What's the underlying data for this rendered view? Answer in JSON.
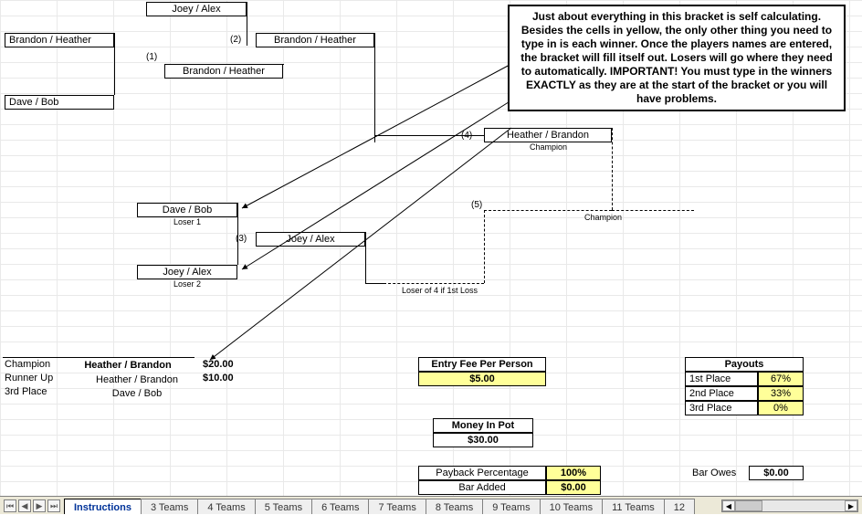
{
  "callout_text": "Just about everything in this bracket is self calculating. Besides the cells in yellow, the only other thing you need to type in is each winner. Once the players names are entered, the bracket will fill itself out. Losers will go where they need to automatically. IMPORTANT! You must type in the winners EXACTLY as they are at the start of the bracket or you will have problems.",
  "bracket": {
    "seed1_team": "Brandon / Heather",
    "seed1_match_label": "(1)",
    "header_team": "Joey / Alex",
    "seed2_box_team": "Brandon / Heather",
    "winner1": "Brandon / Heather",
    "seed2_match_label": "(2)",
    "seed3_team": "Dave / Bob",
    "loser_bracket_top": "Dave / Bob",
    "loser1_label": "Loser 1",
    "seed3_match_label": "(3)",
    "loser_bracket_bot": "Joey / Alex",
    "loser2_label": "Loser 2",
    "loser_winner": "Joey / Alex",
    "seed4_label": "(4)",
    "final_left": "Heather / Brandon",
    "champion_label_small": "Champion",
    "seed5_label": "(5)",
    "champion_label2": "Champion",
    "loser4_label": "Loser of 4 if 1st Loss"
  },
  "results": {
    "champion_label": "Champion",
    "champion_name": "Heather / Brandon",
    "champion_amt": "$20.00",
    "runnerup_label": "Runner Up",
    "runnerup_name": "Heather / Brandon",
    "runnerup_amt": "$10.00",
    "third_label": "3rd Place",
    "third_name": "Dave / Bob"
  },
  "money": {
    "entry_fee_label": "Entry Fee Per Person",
    "entry_fee_value": "$5.00",
    "money_pot_label": "Money In Pot",
    "money_pot_value": "$30.00",
    "payback_pct_label": "Payback Percentage",
    "payback_pct_value": "100%",
    "bar_added_label": "Bar Added",
    "bar_added_value": "$0.00"
  },
  "payouts": {
    "header": "Payouts",
    "first_label": "1st Place",
    "first_pct": "67%",
    "second_label": "2nd Place",
    "second_pct": "33%",
    "third_label": "3rd Place",
    "third_pct": "0%",
    "bar_owes_label": "Bar Owes",
    "bar_owes_value": "$0.00"
  },
  "tabs": {
    "items": [
      {
        "label": "Instructions",
        "active": true
      },
      {
        "label": "3 Teams"
      },
      {
        "label": "4 Teams"
      },
      {
        "label": "5 Teams"
      },
      {
        "label": "6 Teams"
      },
      {
        "label": "7 Teams"
      },
      {
        "label": "8 Teams"
      },
      {
        "label": "9 Teams"
      },
      {
        "label": "10 Teams"
      },
      {
        "label": "11 Teams"
      },
      {
        "label": "12"
      }
    ]
  }
}
